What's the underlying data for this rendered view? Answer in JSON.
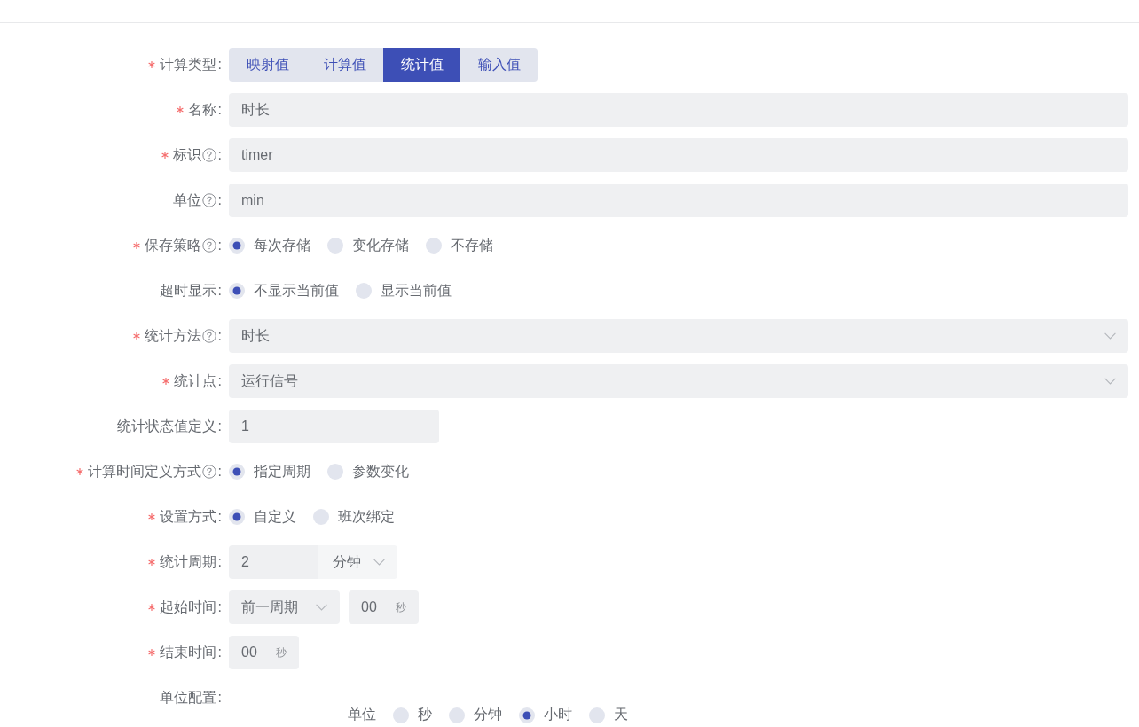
{
  "form": {
    "fields": [
      {
        "kind": "segmented",
        "label": "计算类型",
        "required": true,
        "help": false,
        "colon": ":",
        "options": [
          {
            "label": "映射值",
            "selected": false
          },
          {
            "label": "计算值",
            "selected": false
          },
          {
            "label": "统计值",
            "selected": true
          },
          {
            "label": "输入值",
            "selected": false
          }
        ]
      },
      {
        "kind": "input",
        "label": "名称",
        "required": true,
        "help": false,
        "colon": ":",
        "value": "时长"
      },
      {
        "kind": "input",
        "label": "标识",
        "required": true,
        "help": true,
        "colon": ":",
        "value": "timer"
      },
      {
        "kind": "input",
        "label": "单位",
        "required": false,
        "help": true,
        "colon": ":",
        "value": "min"
      },
      {
        "kind": "radio",
        "label": "保存策略",
        "required": true,
        "help": true,
        "colon": ":",
        "options": [
          {
            "label": "每次存储",
            "selected": true
          },
          {
            "label": "变化存储",
            "selected": false
          },
          {
            "label": "不存储",
            "selected": false
          }
        ]
      },
      {
        "kind": "radio",
        "label": "超时显示",
        "required": false,
        "help": false,
        "colon": ":",
        "options": [
          {
            "label": "不显示当前值",
            "selected": true
          },
          {
            "label": "显示当前值",
            "selected": false
          }
        ]
      },
      {
        "kind": "select",
        "label": "统计方法",
        "required": true,
        "help": true,
        "colon": ":",
        "value": "时长"
      },
      {
        "kind": "select",
        "label": "统计点",
        "required": true,
        "help": false,
        "colon": ":",
        "value": "运行信号"
      },
      {
        "kind": "short_input",
        "label": "统计状态值定义",
        "required": false,
        "help": false,
        "colon": ":",
        "value": "1"
      },
      {
        "kind": "radio",
        "label": "计算时间定义方式",
        "required": true,
        "help": true,
        "colon": ":",
        "options": [
          {
            "label": "指定周期",
            "selected": true
          },
          {
            "label": "参数变化",
            "selected": false
          }
        ]
      },
      {
        "kind": "radio",
        "label": "设置方式",
        "required": true,
        "help": false,
        "colon": ":",
        "options": [
          {
            "label": "自定义",
            "selected": true
          },
          {
            "label": "班次绑定",
            "selected": false
          }
        ]
      },
      {
        "kind": "period",
        "label": "统计周期",
        "required": true,
        "help": false,
        "colon": ":",
        "value": "2",
        "unit": "分钟"
      },
      {
        "kind": "time",
        "label": "起始时间",
        "required": true,
        "help": false,
        "colon": ":",
        "period": "前一周期",
        "value": "00",
        "suffix": "秒"
      },
      {
        "kind": "time",
        "label": "结束时间",
        "required": true,
        "help": false,
        "colon": ":",
        "value": "00",
        "suffix": "秒"
      },
      {
        "kind": "group",
        "label": "单位配置",
        "required": false,
        "help": false,
        "colon": ":",
        "sub_label": "单位",
        "options": [
          {
            "label": "秒",
            "selected": false
          },
          {
            "label": "分钟",
            "selected": false
          },
          {
            "label": "小时",
            "selected": true
          },
          {
            "label": "天",
            "selected": false
          }
        ]
      }
    ]
  }
}
